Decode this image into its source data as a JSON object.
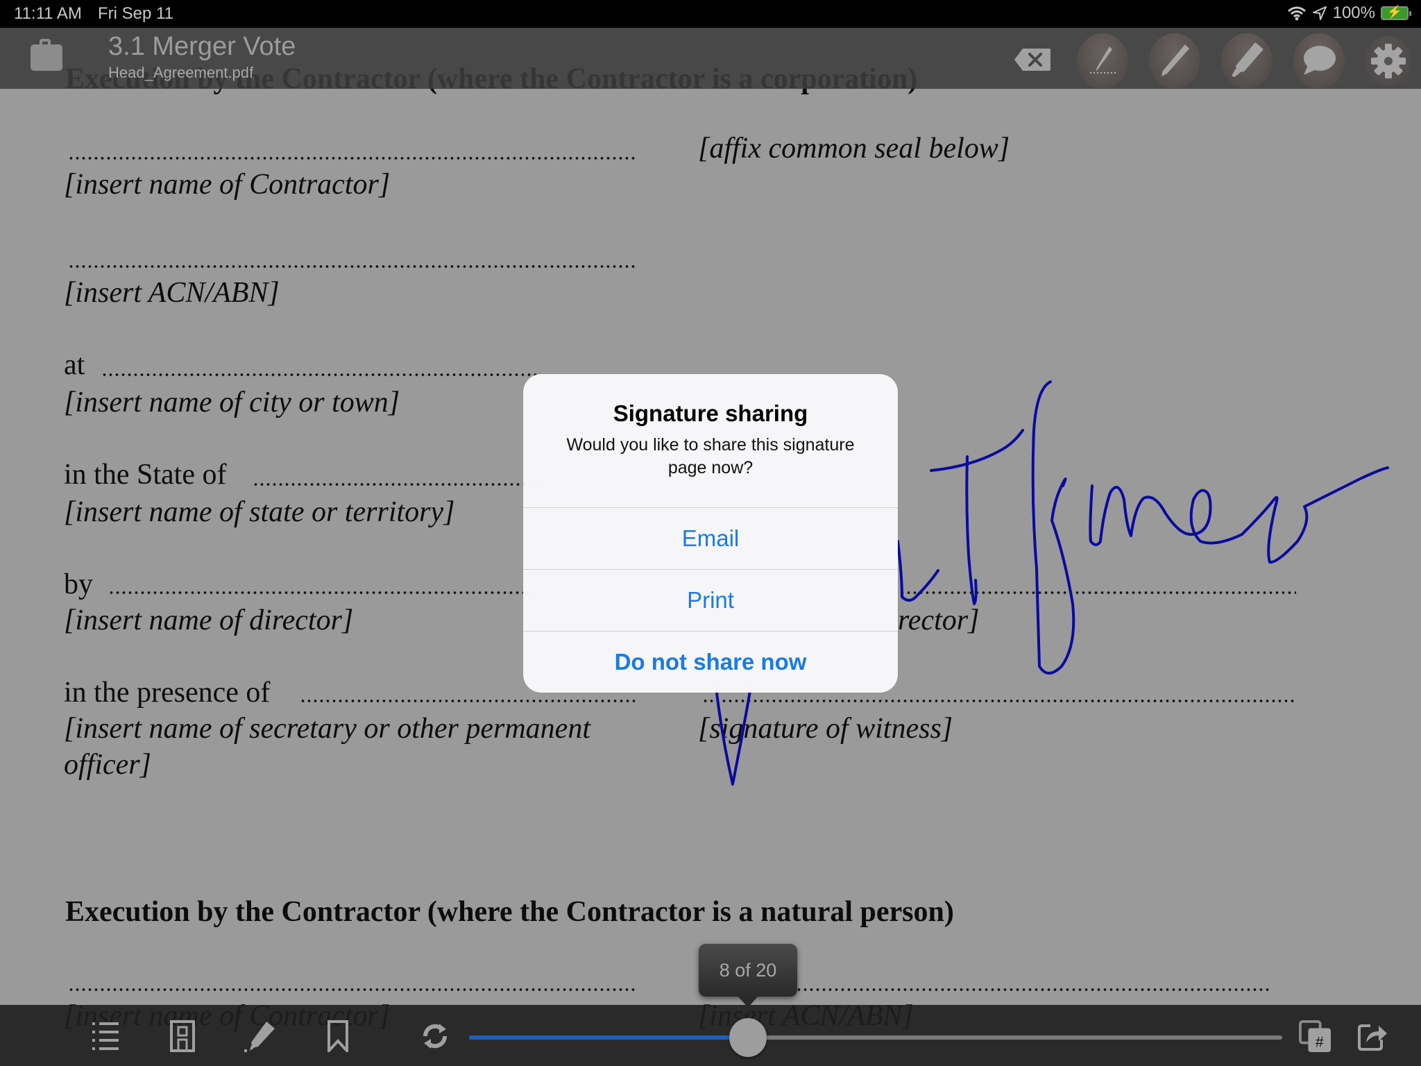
{
  "status_bar": {
    "time": "11:11 AM",
    "date": "Fri Sep 11",
    "battery": "100%",
    "icons": [
      "wifi-icon",
      "location-arrow-icon",
      "battery-charging-icon"
    ]
  },
  "nav": {
    "title": "3.1 Merger Vote",
    "subtitle": "Head_Agreement.pdf",
    "icons": [
      "briefcase-icon",
      "clear-signature-icon",
      "signature-pen-icon",
      "pen-icon",
      "highlighter-icon",
      "comment-icon",
      "settings-gear-icon"
    ]
  },
  "document": {
    "heading_corporation": "Execution by the Contractor (where the Contractor is a corporation)",
    "affix_seal": "[affix common seal below]",
    "name_of_contractor": "[insert name of Contractor]",
    "acn_abn": "[insert ACN/ABN]",
    "at_label": "at",
    "city_or_town": "[insert name of city or town]",
    "state_label": "in the State of",
    "state_or_territory": "[insert name of state or territory]",
    "by_label": "by",
    "name_of_director": "[insert name of director]",
    "director_right_partial": "rector]",
    "presence_label": "in the presence of",
    "secretary_line1": "[insert name of secretary or other permanent",
    "secretary_line2": "officer]",
    "signature_of_witness": "[signature of witness]",
    "heading_natural_person": "Execution by the Contractor (where the Contractor is a natural person)",
    "name_of_contractor_2": "[insert name of Contractor]",
    "acn_abn_2": "[insert ACN/ABN]",
    "signature_ink_color": "#0a0aa0"
  },
  "dialog": {
    "title": "Signature sharing",
    "message": "Would you like to share this signature page now?",
    "buttons": [
      {
        "label": "Email"
      },
      {
        "label": "Print"
      },
      {
        "label": "Do not share now"
      }
    ],
    "accent": "#1a7ae6"
  },
  "bottom_bar": {
    "page_indicator": "8 of 20",
    "current_page": 8,
    "total_pages": 20,
    "icons": [
      "outline-list-icon",
      "page-layout-icon",
      "annotate-highlighter-icon",
      "bookmark-icon",
      "sync-icon",
      "go-to-page-icon",
      "share-icon"
    ],
    "slider_color": "#1f5fb8"
  }
}
